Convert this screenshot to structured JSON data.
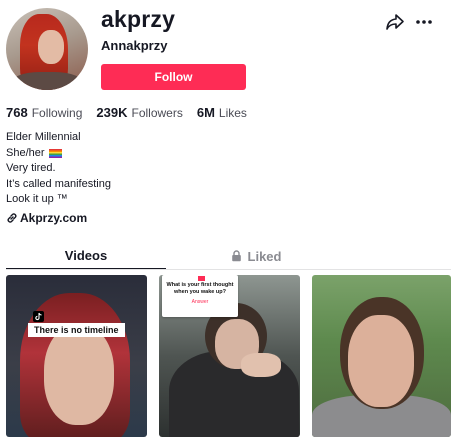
{
  "profile": {
    "username": "akprzy",
    "nickname": "Annakprzy",
    "follow_label": "Follow",
    "stats": [
      {
        "value": "768",
        "label": "Following"
      },
      {
        "value": "239K",
        "label": "Followers"
      },
      {
        "value": "6M",
        "label": "Likes"
      }
    ],
    "bio": [
      "Elder Millennial",
      "She/her",
      "Very tired.",
      "It’s called manifesting",
      "Look it up ™"
    ],
    "link": "Akprzy.com"
  },
  "icons": {
    "share": "share-arrow-icon",
    "more": "more-horizontal-icon",
    "link": "link-icon",
    "lock": "lock-icon",
    "pride_flag": "rainbow-flag-icon"
  },
  "tabs": [
    {
      "label": "Videos",
      "active": true
    },
    {
      "label": "Liked",
      "active": false
    }
  ],
  "videos": [
    {
      "caption": "There is no timeline"
    },
    {
      "card_question": "What is your first thought when you wake up?",
      "card_answer": "Answer"
    },
    {}
  ],
  "colors": {
    "accent": "#fe2c55",
    "text": "#161823",
    "muted": "#8a8b91"
  }
}
